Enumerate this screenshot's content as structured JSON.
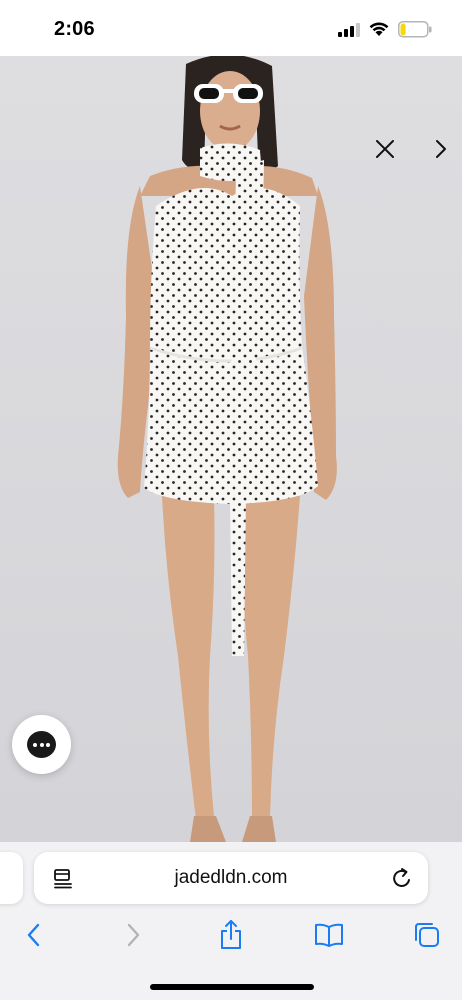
{
  "status_bar": {
    "time": "2:06",
    "signal_bars": 3,
    "battery_level": 0.2,
    "battery_color": "#f5d90a"
  },
  "gallery": {
    "background_color": "#dcdcdf",
    "image": "model-white-polka-dot-halter-dress",
    "close_icon": "close-icon",
    "next_icon": "chevron-right-icon",
    "chat_icon": "chat-bubble-icon"
  },
  "browser": {
    "url": "jadedldn.com",
    "accent_color": "#1a7cf5",
    "reader_icon": "page-menu-icon",
    "reload_icon": "reload-icon",
    "toolbar": [
      "back-icon",
      "forward-icon",
      "share-icon",
      "bookmarks-icon",
      "tabs-icon"
    ],
    "forward_enabled": false
  }
}
